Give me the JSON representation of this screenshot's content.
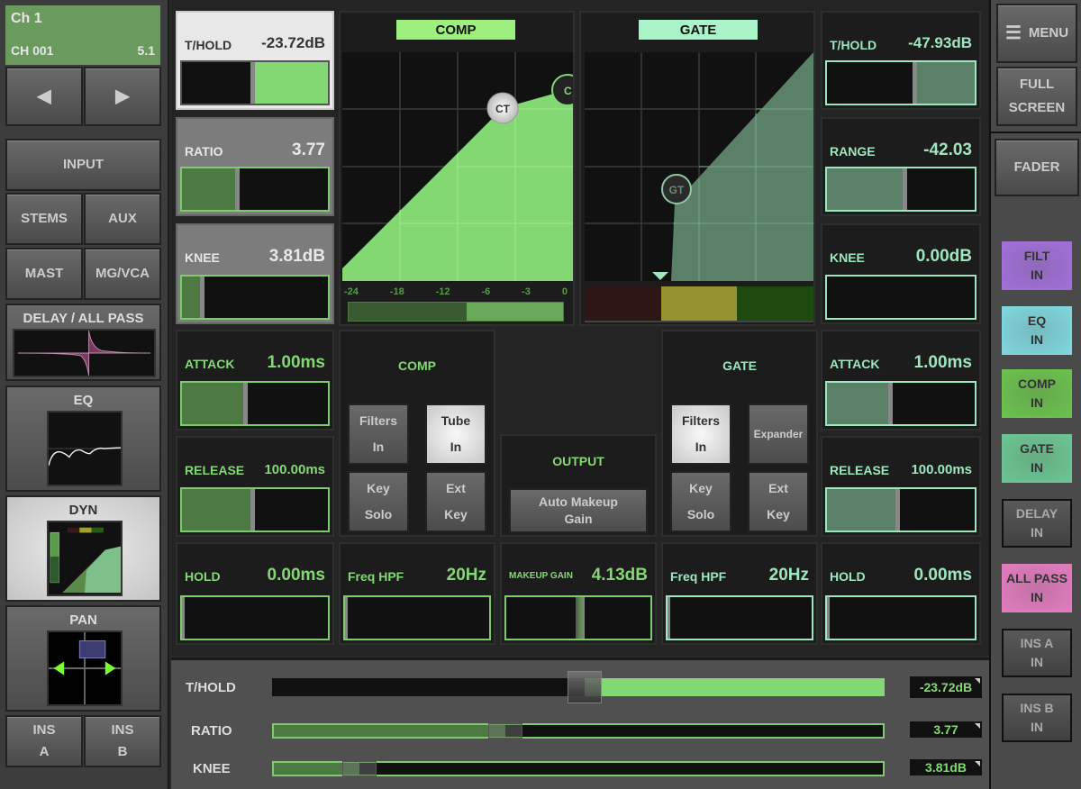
{
  "channel": {
    "name": "Ch 1",
    "id": "CH 001",
    "format": "5.1"
  },
  "nav": {
    "prev": "◀",
    "next": "▶"
  },
  "left": {
    "input": "INPUT",
    "stems": "STEMS",
    "aux": "AUX",
    "mast": "MAST",
    "mgvca": "MG/VCA",
    "delay": "DELAY / ALL PASS",
    "eq": "EQ",
    "dyn": "DYN",
    "pan": "PAN",
    "ins_a": [
      "INS",
      "A"
    ],
    "ins_b": [
      "INS",
      "B"
    ]
  },
  "comp": {
    "title": "COMP",
    "thold": {
      "label": "T/HOLD",
      "value": "-23.72dB",
      "fraction": 0.49
    },
    "ratio": {
      "label": "RATIO",
      "value": "3.77",
      "fraction": 0.38
    },
    "knee": {
      "label": "KNEE",
      "value": "3.81dB",
      "fraction": 0.14
    },
    "attack": {
      "label": "ATTACK",
      "value": "1.00ms",
      "fraction": 0.44
    },
    "release": {
      "label": "RELEASE",
      "value": "100.00ms",
      "fraction": 0.49
    },
    "hold": {
      "label": "HOLD",
      "value": "0.00ms",
      "fraction": 0
    },
    "freq_hpf": {
      "label": "Freq HPF",
      "value": "20Hz",
      "fraction": 0
    },
    "meter_labels": [
      "-24",
      "-18",
      "-12",
      "-6",
      "-3",
      "0"
    ],
    "meter_fraction": 0.55,
    "ct_label": "CT",
    "c_label": "C",
    "section": "COMP",
    "buttons": [
      {
        "l1": "Filters",
        "l2": "In",
        "on": false
      },
      {
        "l1": "Tube",
        "l2": "In",
        "on": true
      },
      {
        "l1": "Key",
        "l2": "Solo",
        "on": false
      },
      {
        "l1": "Ext",
        "l2": "Key",
        "on": false
      }
    ]
  },
  "gate": {
    "title": "GATE",
    "thold": {
      "label": "T/HOLD",
      "value": "-47.93dB",
      "fraction": 0.6
    },
    "range": {
      "label": "RANGE",
      "value": "-42.03",
      "fraction": 0.53
    },
    "knee": {
      "label": "KNEE",
      "value": "0.00dB",
      "fraction": 0
    },
    "attack": {
      "label": "ATTACK",
      "value": "1.00ms",
      "fraction": 0.43
    },
    "release": {
      "label": "RELEASE",
      "value": "100.00ms",
      "fraction": 0.48
    },
    "hold": {
      "label": "HOLD",
      "value": "0.00ms",
      "fraction": 0
    },
    "freq_hpf": {
      "label": "Freq HPF",
      "value": "20Hz",
      "fraction": 0
    },
    "gt_label": "GT",
    "section": "GATE",
    "buttons": [
      {
        "l1": "Filters",
        "l2": "In",
        "on": true
      },
      {
        "l1": "Expander",
        "l2": "",
        "on": false
      },
      {
        "l1": "Key",
        "l2": "Solo",
        "on": false
      },
      {
        "l1": "Ext",
        "l2": "Key",
        "on": false
      }
    ]
  },
  "output": {
    "title": "OUTPUT",
    "auto_makeup": [
      "Auto Makeup",
      "Gain"
    ],
    "makeup": {
      "label": "MAKEUP GAIN",
      "value": "4.13dB",
      "fraction": 0.5
    }
  },
  "bottom": {
    "thold": {
      "label": "T/HOLD",
      "value": "-23.72dB",
      "fraction": 0.51
    },
    "ratio": {
      "label": "RATIO",
      "value": "3.77",
      "fraction": 0.38
    },
    "knee": {
      "label": "KNEE",
      "value": "3.81dB",
      "fraction": 0.14
    }
  },
  "right": {
    "menu": "MENU",
    "full": [
      "FULL",
      "SCREEN"
    ],
    "fader": "FADER",
    "toggles": [
      {
        "l1": "FILT",
        "l2": "IN",
        "color": "#a070d8"
      },
      {
        "l1": "EQ",
        "l2": "IN",
        "color": "#7fd6dc"
      },
      {
        "l1": "COMP",
        "l2": "IN",
        "color": "#6cc04e"
      },
      {
        "l1": "GATE",
        "l2": "IN",
        "color": "#6cc492"
      },
      {
        "l1": "DELAY",
        "l2": "IN",
        "color": null
      },
      {
        "l1": "ALL PASS",
        "l2": "IN",
        "color": "#e07cbc"
      },
      {
        "l1": "INS A",
        "l2": "IN",
        "color": null
      },
      {
        "l1": "INS B",
        "l2": "IN",
        "color": null
      }
    ]
  }
}
